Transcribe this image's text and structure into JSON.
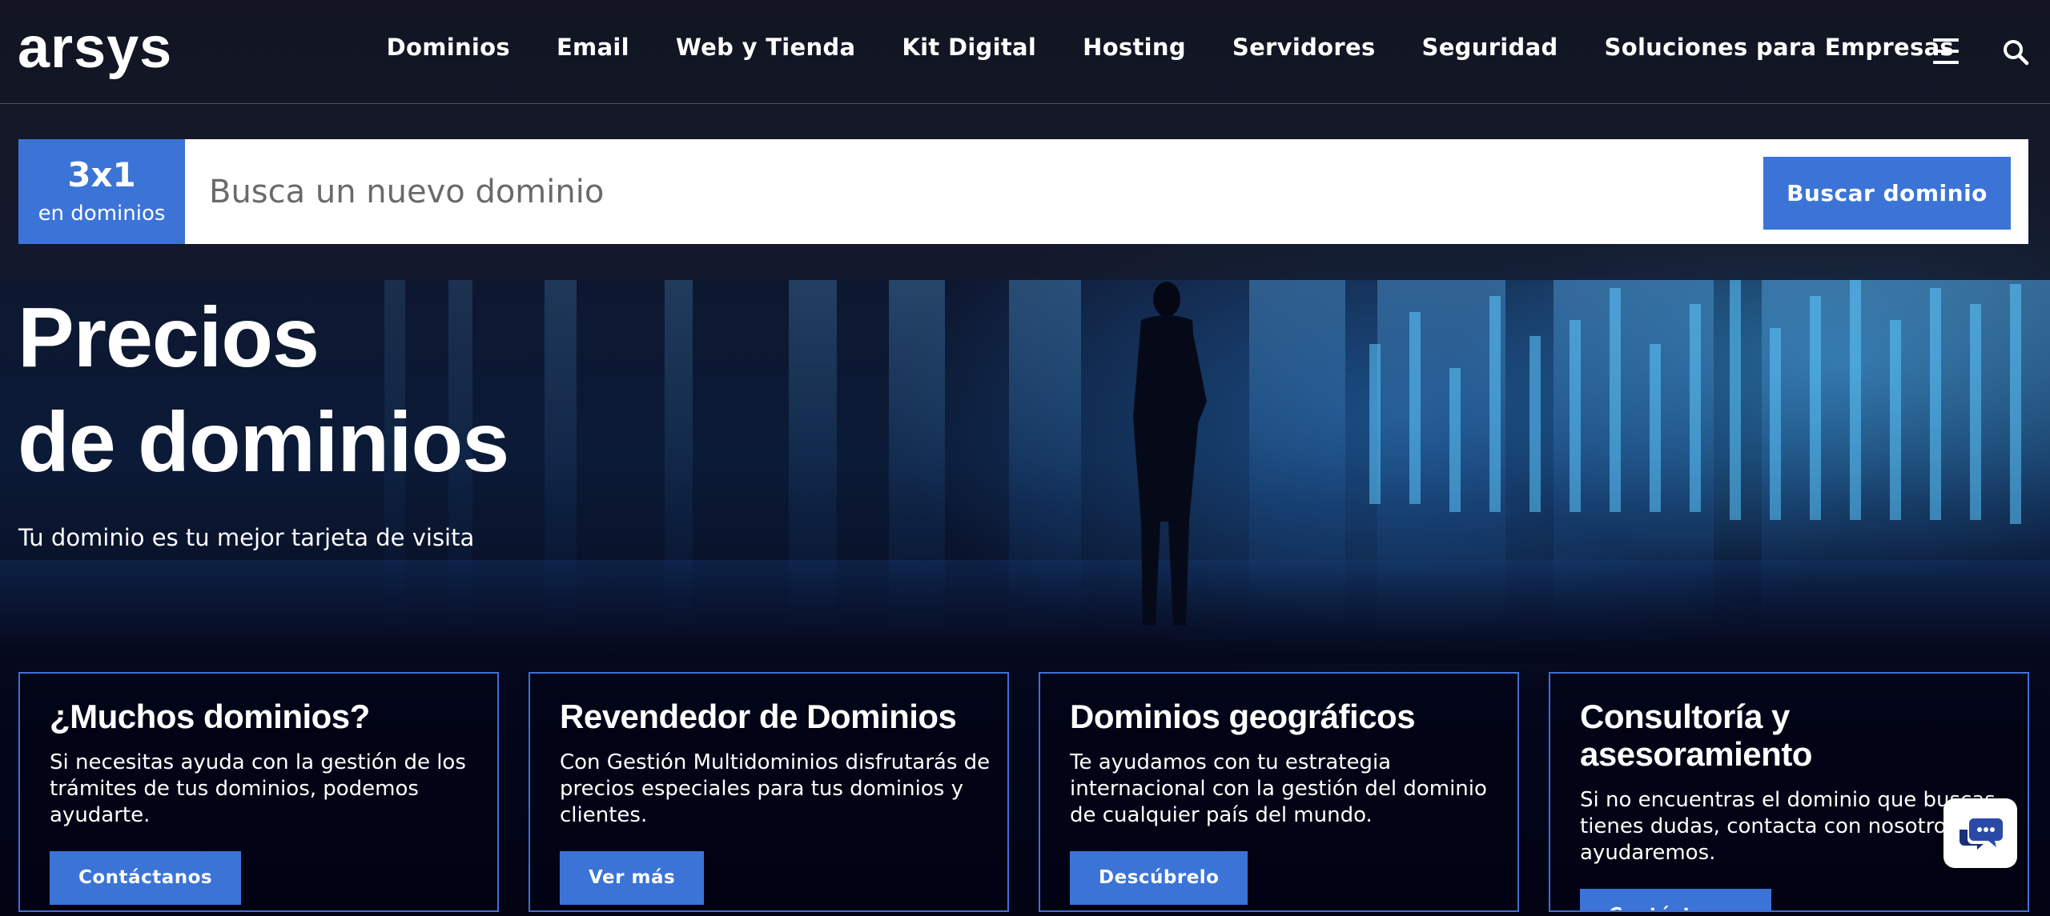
{
  "brand": {
    "logo_text": "arsys",
    "accent_color": "#3b74d6",
    "card_border_color": "#3f6fd8"
  },
  "nav": {
    "items": [
      {
        "label": "Dominios"
      },
      {
        "label": "Email"
      },
      {
        "label": "Web y Tienda"
      },
      {
        "label": "Kit Digital"
      },
      {
        "label": "Hosting"
      },
      {
        "label": "Servidores"
      },
      {
        "label": "Seguridad"
      },
      {
        "label": "Soluciones para Empresas"
      }
    ],
    "menu_icon": "hamburger-menu-icon",
    "search_icon": "search-icon"
  },
  "search": {
    "promo_big": "3x1",
    "promo_small": "en dominios",
    "placeholder": "Busca un nuevo dominio",
    "button_label": "Buscar dominio"
  },
  "hero": {
    "title_line1": "Precios",
    "title_line2": "de dominios",
    "subtitle": "Tu dominio es tu mejor tarjeta de visita"
  },
  "cards": [
    {
      "title": "¿Muchos dominios?",
      "text": "Si necesitas ayuda con la gestión de los trámites de tus dominios, podemos ayudarte.",
      "button": "Contáctanos"
    },
    {
      "title": "Revendedor de Dominios",
      "text": "Con Gestión Multidominios disfrutarás de precios especiales para tus dominios y clientes.",
      "button": "Ver más"
    },
    {
      "title": "Dominios geográficos",
      "text": "Te ayudamos con tu estrategia internacional con la gestión del dominio de cualquier país del mundo.",
      "button": "Descúbrelo"
    },
    {
      "title": "Consultoría y asesoramiento",
      "text": "Si no encuentras el dominio que buscas, tienes dudas, contacta con nosotros y te ayudaremos.",
      "button": "Contáctanos"
    }
  ],
  "chat": {
    "icon": "chat-bubble-icon"
  }
}
